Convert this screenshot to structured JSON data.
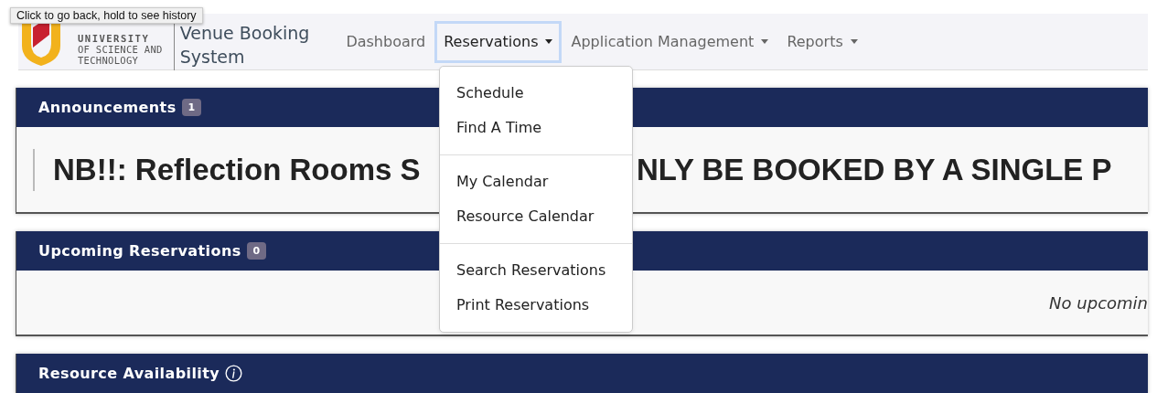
{
  "tooltip": {
    "text": "Click to go back, hold to see history"
  },
  "brand": {
    "university_lines": [
      "UNIVERSITY",
      "OF SCIENCE AND",
      "TECHNOLOGY"
    ],
    "title_lines": [
      "Venue Booking",
      "System"
    ]
  },
  "nav": [
    {
      "label": "Dashboard",
      "selected": false,
      "has_caret": false
    },
    {
      "label": "Reservations",
      "selected": true,
      "has_caret": true
    },
    {
      "label": "Application Management",
      "selected": false,
      "has_caret": true
    },
    {
      "label": "Reports",
      "selected": false,
      "has_caret": true
    }
  ],
  "dropdown": {
    "groups": [
      [
        "Schedule",
        "Find A Time"
      ],
      [
        "My Calendar",
        "Resource Calendar"
      ],
      [
        "Search Reservations",
        "Print Reservations"
      ]
    ]
  },
  "panels": [
    {
      "kind": "announcement",
      "title": "Announcements",
      "badge": "1",
      "text_parts": [
        "NB!!: Reflection Rooms S",
        "NLY BE BOOKED BY A SINGLE P"
      ]
    },
    {
      "kind": "message",
      "title": "Upcoming Reservations",
      "badge": "0",
      "message": "No upcomin"
    },
    {
      "kind": "info",
      "title": "Resource Availability"
    }
  ]
}
